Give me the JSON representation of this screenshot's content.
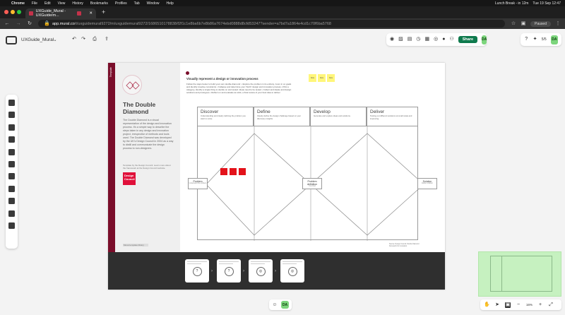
{
  "os_menubar": {
    "app": "Chrome",
    "menus": [
      "File",
      "Edit",
      "View",
      "History",
      "Bookmarks",
      "Profiles",
      "Tab",
      "Window",
      "Help"
    ],
    "status": "Lunch Break - in 12m",
    "datetime": "Tue 19 Sep 12:47"
  },
  "browser": {
    "tabs": [
      {
        "label": "UXGuide_Mural - UXGuide/m...",
        "active": true
      },
      {
        "label": "",
        "active": false
      }
    ],
    "new_tab": "+",
    "url_host": "app.mural.co",
    "url_path": "/t/uxguidemural9272/m/uxguidemural9272/1686510178838/f2f1c1e8ba6b7e8b86a7674ebd0888d8cfd53247?sender=a7bd7a1864e4cd1c70f6ba5768",
    "profile_status": "Paused"
  },
  "mural": {
    "doc_title": "UXGuide_Mural",
    "share_label": "Share",
    "share_sub": "Free",
    "avatar_initials": "DA",
    "timer_value": "5/5",
    "zoom_level": "16%"
  },
  "board": {
    "strip_label": "Template",
    "title_line1": "The Double",
    "title_line2": "Diamond",
    "description": "The Double Diamond is a visual representation of the design and innovation process. It's a simple way to describe the steps taken in any design and innovation project, irrespective of methods and tools used. The Double Diamond was developed by the UK's Design Council in 2004 as a way to distill and communicate the design process to non-designers.",
    "credit": "Template by the Design Council. Learn more about the framework at the Design Council website.",
    "brand_line1": "Design",
    "brand_line2": "Council",
    "footer_tag": "Mural template library",
    "visual_heading": "Visually represent a design or innovation process",
    "visual_text": "Follow the steps below to build your own double diamond: • Explore the problem in its entirety, zoom in on goals and identify creative constraints • Collapse and determine your 'North' design and innovation process • Pick a category, identify a single thing to decide on and tested. Ideas need to be tested • Collect and ideate and design solutions and prototypes • Reflect on and evaluate as stick, a final review of your best idea to deliver",
    "sticky_notes": [
      "Note",
      "Note",
      "Note"
    ],
    "phases": [
      {
        "name": "Discover",
        "text": "Understanding and clearly defining the problem you want to solve."
      },
      {
        "name": "Define",
        "text": "Clearly define the design challenge based on your discovery insights."
      },
      {
        "name": "Develop",
        "text": "Generate and explore ideas and solutions."
      },
      {
        "name": "Deliver",
        "text": "Testing out different solutions at small scale and improving."
      }
    ],
    "nodes": [
      {
        "name": "Problem",
        "text": "Understand the problem"
      },
      {
        "name": "Problem definition",
        "text": "Your brief"
      },
      {
        "name": "Solution",
        "text": "Deliver solution"
      }
    ],
    "footnote": "Source: Design Council. Double Diamond framework for innovation.",
    "mini_cards": [
      {
        "glyph": "?"
      },
      {
        "glyph": "?"
      },
      {
        "glyph": "◎"
      },
      {
        "glyph": "◎"
      }
    ]
  },
  "colors": {
    "brand_dark": "#7a0d2a",
    "share_green": "#0f7a4d",
    "avatar_green": "#7cd57c",
    "minimap_green": "#c6f1c0",
    "sticky_yellow": "#fff67a",
    "sticky_red": "#e3121a"
  }
}
